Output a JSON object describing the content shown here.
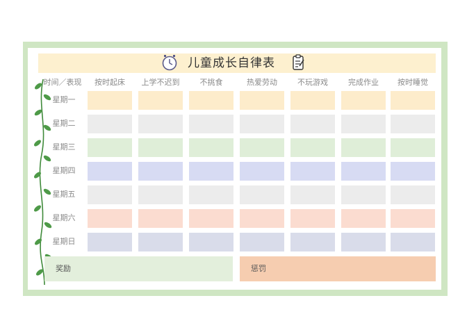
{
  "title": "儿童成长自律表",
  "header_corner": "时间／表现",
  "columns": [
    "按时起床",
    "上学不迟到",
    "不挑食",
    "热爱劳动",
    "不玩游戏",
    "完成作业",
    "按时睡觉"
  ],
  "days": [
    "星期一",
    "星期二",
    "星期三",
    "星期四",
    "星期五",
    "星期六",
    "星期日"
  ],
  "row_colors": [
    "#fdeccb",
    "#ececec",
    "#dfeed8",
    "#d7dbf3",
    "#ececec",
    "#fbdcd0",
    "#d9dcea"
  ],
  "reward_label": "奖励",
  "punish_label": "惩罚",
  "colors": {
    "frame": "#cfe6c3",
    "title_bar": "#fdf0cf",
    "reward_bg": "#e3efdc",
    "punish_bg": "#f6cdb0",
    "vine": "#3f8a3a"
  },
  "icons": [
    "clock-icon",
    "clipboard-icon",
    "vine-decoration"
  ]
}
